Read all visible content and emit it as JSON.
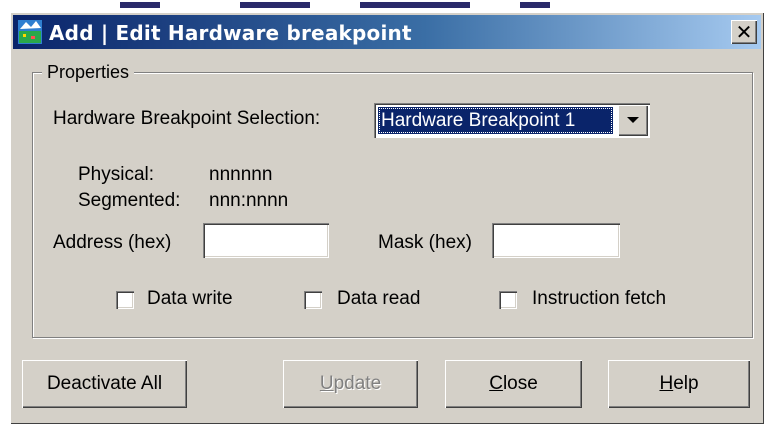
{
  "window": {
    "title": "Add | Edit Hardware breakpoint",
    "close_glyph": "✕"
  },
  "properties": {
    "group_label": "Properties",
    "selection_label": "Hardware Breakpoint Selection:",
    "selection_value": "Hardware Breakpoint 1",
    "physical_label": "Physical:",
    "physical_value": "nnnnnn",
    "segmented_label": "Segmented:",
    "segmented_value": "nnn:nnnn",
    "address_label": "Address (hex)",
    "address_value": "",
    "mask_label": "Mask (hex)",
    "mask_value": "",
    "checkboxes": [
      {
        "label": "Data write",
        "checked": false
      },
      {
        "label": "Data read",
        "checked": false
      },
      {
        "label": "Instruction fetch",
        "checked": false
      }
    ]
  },
  "buttons": {
    "deactivate_all": "Deactivate All",
    "update": {
      "mnemonic": "U",
      "rest": "pdate",
      "enabled": false
    },
    "close": {
      "mnemonic": "C",
      "rest": "lose"
    },
    "help": {
      "mnemonic": "H",
      "rest": "elp"
    }
  },
  "icons": {
    "app": "app-icon",
    "dropdown": "chevron-down-icon",
    "close": "close-icon"
  },
  "colors": {
    "titlebar_start": "#0a246a",
    "titlebar_end": "#a6caf0",
    "face": "#d4d0c8",
    "selection": "#0a246a"
  }
}
